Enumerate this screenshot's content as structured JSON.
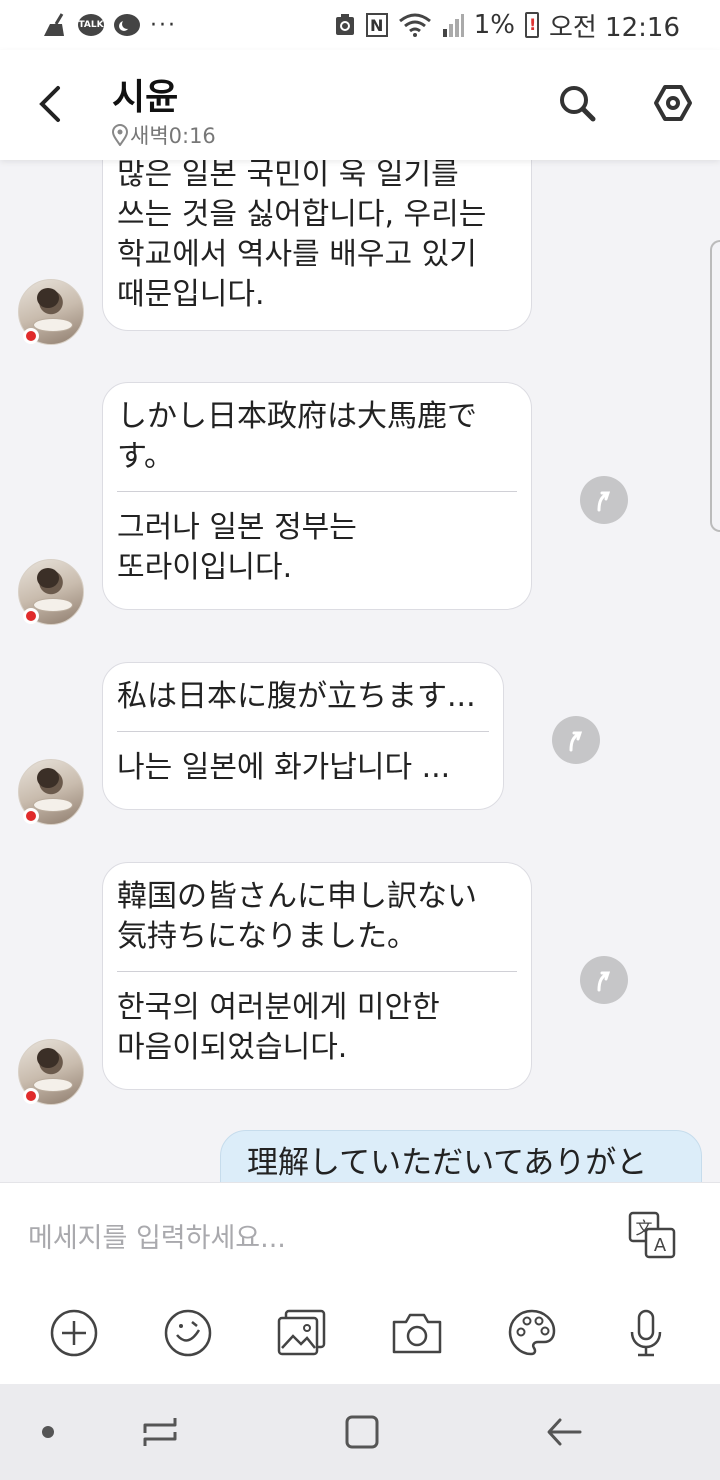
{
  "status_bar": {
    "talk_label": "TALK",
    "dots": "···",
    "nfc_label": "N",
    "battery_percent": "1%",
    "time": "오전 12:16"
  },
  "header": {
    "title": "시윤",
    "subtitle": "새벽0:16"
  },
  "messages": [
    {
      "lines": [
        "많은 일본 국민이 욱 일기를",
        "쓰는 것을 싫어합니다, 우리는",
        "학교에서 역사를 배우고 있기",
        "때문입니다."
      ]
    },
    {
      "original_lines": [
        "しかし日本政府は大馬鹿で",
        "す。"
      ],
      "translated_lines": [
        "그러나 일본 정부는",
        "또라이입니다."
      ]
    },
    {
      "original_lines": [
        "私は日本に腹が立ちます..."
      ],
      "translated_lines": [
        "나는 일본에 화가납니다 ..."
      ]
    },
    {
      "original_lines": [
        "韓国の皆さんに申し訳ない",
        "気持ちになりました。"
      ],
      "translated_lines": [
        "한국의 여러분에게 미안한",
        "마음이되었습니다."
      ]
    }
  ],
  "my_message": {
    "text": "理解していただいてありがと"
  },
  "input": {
    "placeholder": "메세지를 입력하세요..."
  },
  "toolbar": [
    "add-icon",
    "emoji-icon",
    "gallery-icon",
    "camera-icon",
    "palette-icon",
    "mic-icon"
  ],
  "colors": {
    "chat_background": "#f3f3f6",
    "my_bubble": "#dcedf9",
    "unread_dot": "#e02b2b"
  }
}
